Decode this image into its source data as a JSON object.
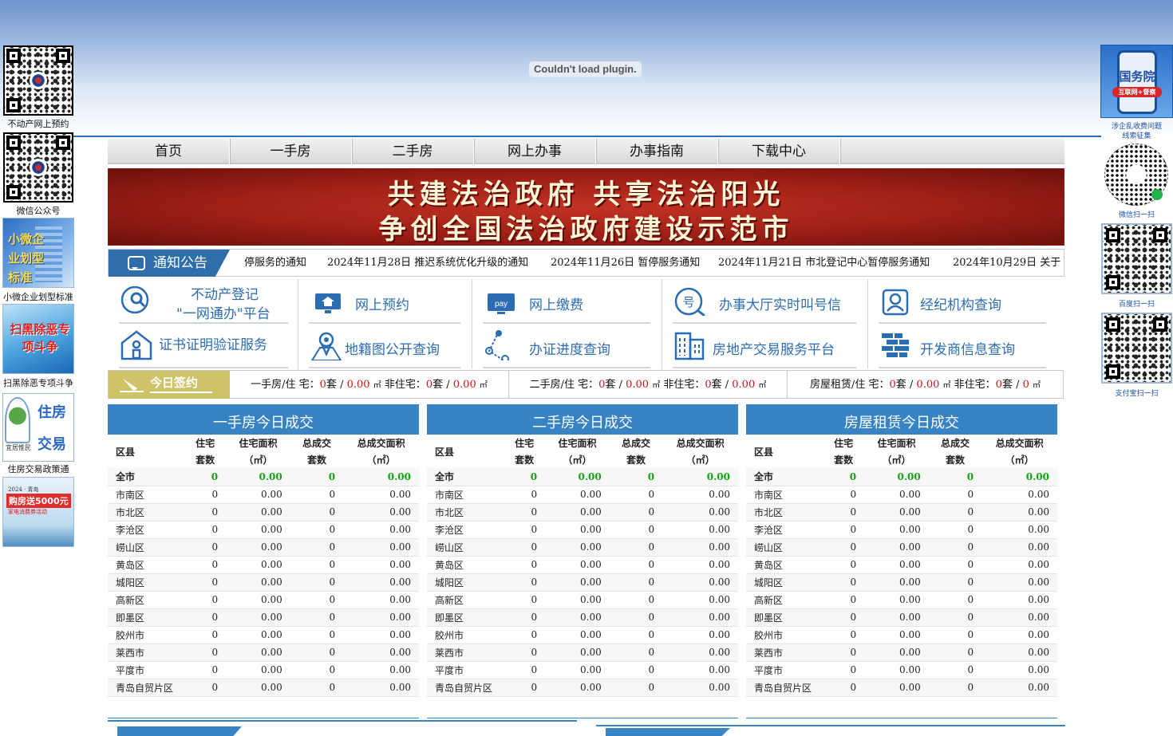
{
  "plugin_message": "Couldn't load plugin.",
  "left_rail": {
    "qr1_caption": "不动产网上预约",
    "qr2_caption": "微信公众号",
    "banner1": {
      "text": "小微企业划型标准",
      "caption": "小微企业划型标准"
    },
    "banner2": {
      "text": "扫黑除恶专项斗争",
      "caption": "扫黑除恶专项斗争"
    },
    "banner3": {
      "text": "住房交易政策通",
      "brand": "宜居惟民",
      "caption": "住房交易政策通"
    },
    "banner4": {
      "top": "2024 · 青岛",
      "main": "购房送5000元",
      "sub": "家电消费券活动"
    }
  },
  "right_rail": {
    "gov_banner": {
      "title": "国务院",
      "tag": "互联网+督察"
    },
    "gov_caption_1": "涉企乱收费问题",
    "gov_caption_2": "线索征集",
    "qr_captions": [
      "微信扫一扫",
      "百度扫一扫",
      "支付宝扫一扫"
    ]
  },
  "nav": [
    "首页",
    "一手房",
    "二手房",
    "网上办事",
    "办事指南",
    "下载中心"
  ],
  "hero": {
    "line1": "共建法治政府  共享法治阳光",
    "line2": "争创全国法治政府建设示范市"
  },
  "notice": {
    "title": "通知公告",
    "items": [
      "停服务的通知",
      "2024年11月28日 推迟系统优化升级的通知",
      "2024年11月26日 暂停服务通知",
      "2024年11月21日 市北登记中心暂停服务通知",
      "2024年10月29日 关于"
    ]
  },
  "services": [
    {
      "label1": "不动产登记",
      "label2": "\"一网通办\"平台",
      "icon": "search-icon"
    },
    {
      "label1": "网上预约",
      "icon": "monitor-home-icon"
    },
    {
      "label1": "网上缴费",
      "icon": "pay-monitor-icon",
      "icon_text": "pay"
    },
    {
      "label1": "办事大厅实时叫号信",
      "icon": "queue-number-icon",
      "icon_text": "号"
    },
    {
      "label1": "经纪机构查询",
      "icon": "user-search-icon"
    },
    {
      "label1": "证书证明验证服务",
      "icon": "house-verify-icon"
    },
    {
      "label1": "地籍图公开查询",
      "icon": "map-pin-icon"
    },
    {
      "label1": "办证进度查询",
      "icon": "progress-triangle-icon"
    },
    {
      "label1": "房地产交易服务平台",
      "icon": "building-icon"
    },
    {
      "label1": "开发商信息查询",
      "icon": "brick-wall-icon"
    }
  ],
  "today": {
    "title": "今日签约",
    "segments": [
      {
        "prefix": "一手房/住 宅：",
        "a": "0",
        "unit_t": "套",
        "sep": " / ",
        "b": "0.00",
        "unit_a": "㎡",
        "mid": " 非住宅：",
        "c": "0",
        "d": "0.00"
      },
      {
        "prefix": "二手房/住 宅：",
        "a": "0",
        "unit_t": "套",
        "sep": " / ",
        "b": "0.00",
        "unit_a": "㎡",
        "mid": " 非住宅：",
        "c": "0",
        "d": "0.00"
      },
      {
        "prefix": "房屋租赁/住 宅：",
        "a": "0",
        "unit_t": "套",
        "sep": " / ",
        "b": "0.00",
        "unit_a": "㎡",
        "mid": " 非住宅：",
        "c": "0",
        "d": "0"
      }
    ]
  },
  "tables": [
    {
      "title": "一手房今日成交"
    },
    {
      "title": "二手房今日成交"
    },
    {
      "title": "房屋租赁今日成交"
    }
  ],
  "table_header": {
    "district": "区县",
    "c1a": "住宅",
    "c1b": "套数",
    "c2a": "住宅面积",
    "c2b": "（㎡）",
    "c3a": "总成交",
    "c3b": "套数",
    "c4a": "总成交面积",
    "c4b": "（㎡）"
  },
  "rows": [
    {
      "name": "全市",
      "v1": "0",
      "v2": "0.00",
      "v3": "0",
      "v4": "0.00"
    },
    {
      "name": "市南区",
      "v1": "0",
      "v2": "0.00",
      "v3": "0",
      "v4": "0.00"
    },
    {
      "name": "市北区",
      "v1": "0",
      "v2": "0.00",
      "v3": "0",
      "v4": "0.00"
    },
    {
      "name": "李沧区",
      "v1": "0",
      "v2": "0.00",
      "v3": "0",
      "v4": "0.00"
    },
    {
      "name": "崂山区",
      "v1": "0",
      "v2": "0.00",
      "v3": "0",
      "v4": "0.00"
    },
    {
      "name": "黄岛区",
      "v1": "0",
      "v2": "0.00",
      "v3": "0",
      "v4": "0.00"
    },
    {
      "name": "城阳区",
      "v1": "0",
      "v2": "0.00",
      "v3": "0",
      "v4": "0.00"
    },
    {
      "name": "高新区",
      "v1": "0",
      "v2": "0.00",
      "v3": "0",
      "v4": "0.00"
    },
    {
      "name": "即墨区",
      "v1": "0",
      "v2": "0.00",
      "v3": "0",
      "v4": "0.00"
    },
    {
      "name": "胶州市",
      "v1": "0",
      "v2": "0.00",
      "v3": "0",
      "v4": "0.00"
    },
    {
      "name": "莱西市",
      "v1": "0",
      "v2": "0.00",
      "v3": "0",
      "v4": "0.00"
    },
    {
      "name": "平度市",
      "v1": "0",
      "v2": "0.00",
      "v3": "0",
      "v4": "0.00"
    },
    {
      "name": "青岛自贸片区",
      "v1": "0",
      "v2": "0.00",
      "v3": "0",
      "v4": "0.00"
    }
  ],
  "colors": {
    "brand_blue": "#3783c4",
    "link_blue": "#2c6cb2",
    "total_green": "#16a316",
    "number_red": "#c9141b",
    "hero_red": "#9e1f16"
  }
}
